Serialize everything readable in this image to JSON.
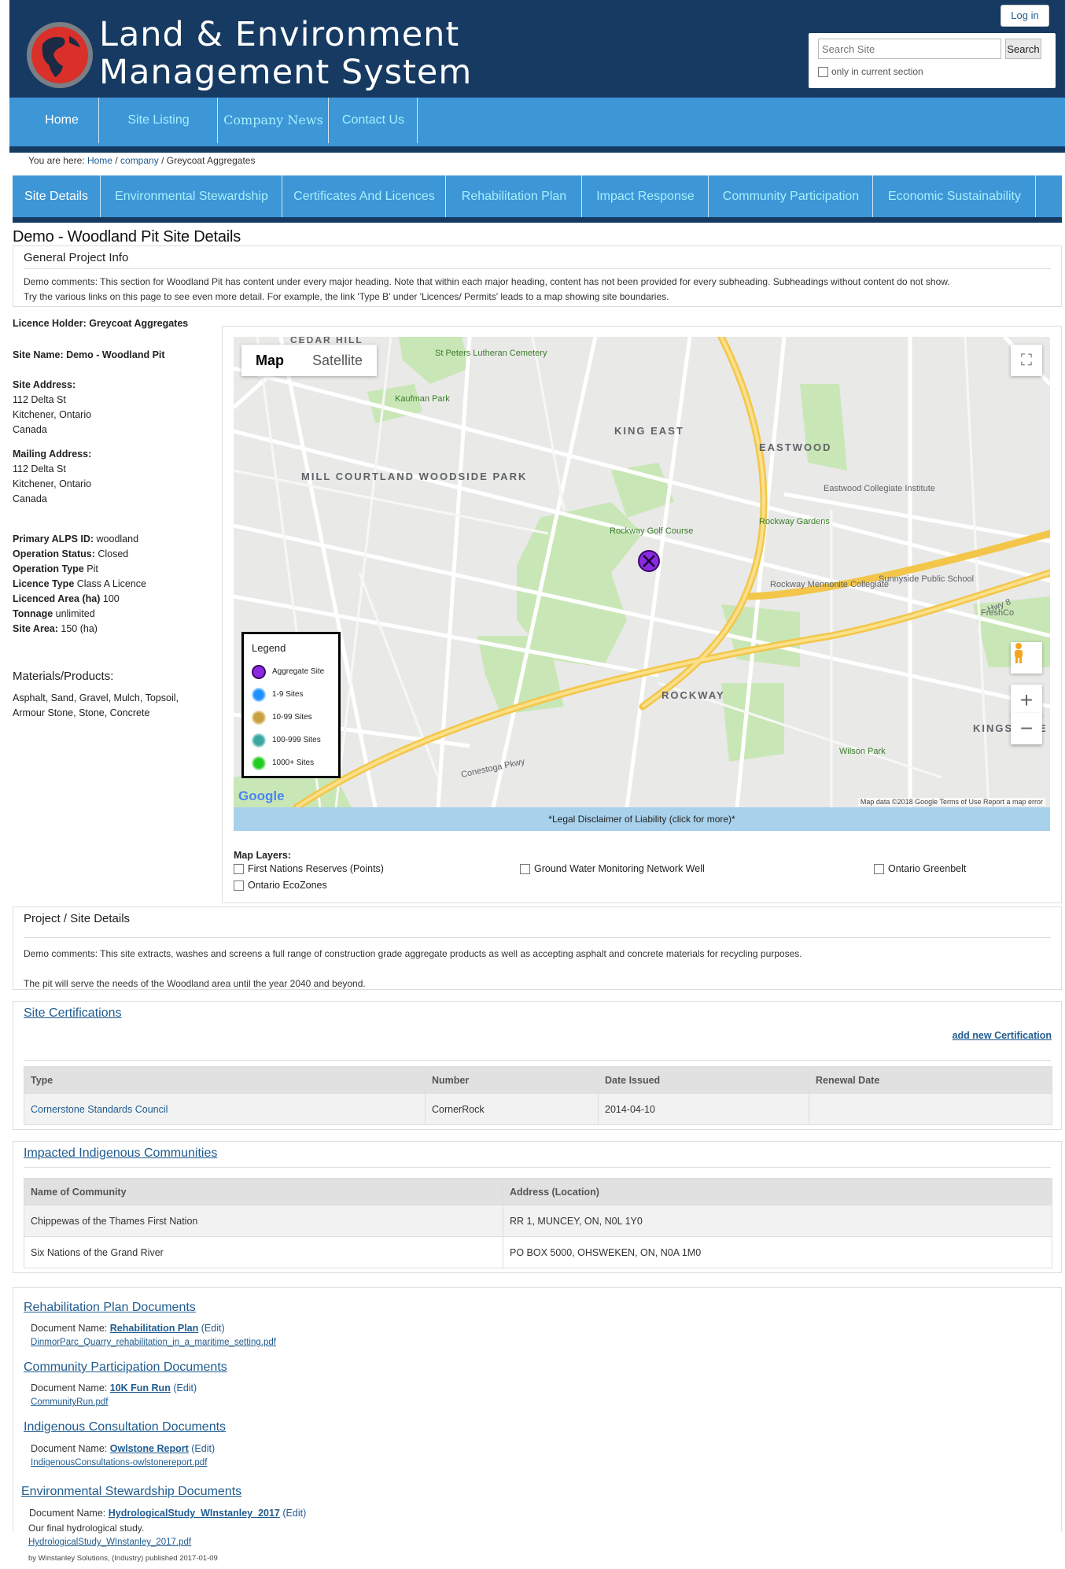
{
  "header": {
    "title_line1": "Land & Environment",
    "title_line2": "Management System",
    "login_label": "Log in",
    "search_placeholder": "Search Site",
    "search_button": "Search",
    "only_current_section": "only in current section",
    "brand_color": "#163a62",
    "nav_color": "#3d96d6"
  },
  "nav": {
    "home": "Home",
    "site_listing": "Site Listing",
    "company_news": "Company News",
    "contact_us": "Contact Us"
  },
  "breadcrumb": {
    "prefix": "You are here:",
    "home": "Home",
    "sep1": "/",
    "company": "company",
    "sep2": "/",
    "current": "Greycoat Aggregates"
  },
  "tabs": [
    {
      "label": "Site Details"
    },
    {
      "label": "Environmental Stewardship"
    },
    {
      "label": "Certificates And Licences"
    },
    {
      "label": "Rehabilitation Plan"
    },
    {
      "label": "Impact Response"
    },
    {
      "label": "Community Participation"
    },
    {
      "label": "Economic Sustainability"
    }
  ],
  "page_title": "Demo - Woodland Pit Site Details",
  "general_info": {
    "heading": "General Project Info",
    "line1": "Demo comments: This section for Woodland Pit has content under every major heading.  Note that within each major heading, content has not been provided for every subheading.  Subheadings without content do not show.",
    "line2": "Try the various links on this page to see even more detail.  For example, the link 'Type B' under 'Licences/ Permits' leads to a map showing site boundaries."
  },
  "site": {
    "licence_holder": "Licence Holder: Greycoat Aggregates",
    "site_name": "Site Name: Demo - Woodland Pit",
    "site_address_label": "Site Address:",
    "site_address": [
      "112 Delta St",
      "Kitchener, Ontario",
      "Canada"
    ],
    "mailing_address_label": "Mailing Address:",
    "mailing_address": [
      "112 Delta St",
      "Kitchener, Ontario",
      "Canada"
    ],
    "details": [
      {
        "label": "Primary ALPS ID:",
        "value": " woodland"
      },
      {
        "label": "Operation Status:",
        "value": " Closed"
      },
      {
        "label": "Operation Type",
        "value": " Pit"
      },
      {
        "label": "Licence Type",
        "value": " Class A Licence"
      },
      {
        "label": "Licenced Area (ha)",
        "value": " 100"
      },
      {
        "label": "Tonnage",
        "value": " unlimited"
      },
      {
        "label": "Site Area:",
        "value": " 150 (ha)"
      }
    ],
    "materials_heading": "Materials/Products:",
    "materials_line1": "Asphalt, Sand, Gravel, Mulch, Topsoil,",
    "materials_line2": "Armour Stone, Stone, Concrete"
  },
  "map": {
    "map_button": "Map",
    "satellite_button": "Satellite",
    "legend_title": "Legend",
    "legend": [
      {
        "label": "Aggregate Site",
        "color": "#8a2be2"
      },
      {
        "label": "1-9 Sites",
        "color": "#1e90ff"
      },
      {
        "label": "10-99 Sites",
        "color": "#c8a040"
      },
      {
        "label": "100-999 Sites",
        "color": "#3aa6a0"
      },
      {
        "label": "1000+ Sites",
        "color": "#22cc22"
      }
    ],
    "labels": [
      "CEDAR HILL",
      "Kaufman Park",
      "St Peters Lutheran Cemetery",
      "KING EAST",
      "EASTWOOD",
      "MILL COURTLAND WOODSIDE PARK",
      "Rockway Golf Course",
      "Rockway Gardens",
      "Eastwood Collegiate Institute",
      "Sunnyside Public School",
      "Rockway Mennonite Collegiate",
      "FreshCo",
      "ROCKWAY",
      "Conestoga Pkwy",
      "Wilson Park",
      "KINGSDALE",
      "Hwy 8"
    ],
    "google": "Google",
    "attribution": "Map data ©2018 Google   Terms of Use   Report a map error",
    "disclaimer": "*Legal Disclaimer of Liability (click for more)*",
    "layers_heading": "Map Layers:",
    "layers": [
      "First Nations Reserves (Points)",
      "Ground Water Monitoring Network Well",
      "Ontario Greenbelt",
      "Ontario EcoZones"
    ]
  },
  "project_details": {
    "heading": "Project / Site Details",
    "line1": "Demo comments: This site extracts, washes and screens a full range of construction grade aggregate products as well as accepting asphalt and concrete materials for recycling purposes.",
    "line2": "The pit will serve the needs of the Woodland area until the year 2040 and beyond."
  },
  "certifications": {
    "heading": "Site Certifications",
    "add_new": "add new Certification",
    "columns": [
      "Type",
      "Number",
      "Date Issued",
      "Renewal Date"
    ],
    "rows": [
      {
        "type": "Cornerstone Standards Council",
        "number": "CornerRock",
        "date_issued": "2014-04-10",
        "renewal": ""
      }
    ]
  },
  "communities": {
    "heading": "Impacted Indigenous Communities",
    "columns": [
      "Name of Community",
      "Address (Location)"
    ],
    "rows": [
      {
        "name": "Chippewas of the Thames First Nation",
        "address": "RR 1, MUNCEY, ON, N0L 1Y0"
      },
      {
        "name": "Six Nations of the Grand River",
        "address": "PO BOX 5000, OHSWEKEN, ON, N0A 1M0"
      }
    ]
  },
  "documents": {
    "doc_name_label": "Document Name:",
    "edit_label": "(Edit)",
    "groups": [
      {
        "heading": "Rehabilitation Plan Documents",
        "name": "Rehabilitation Plan",
        "file": "DinmorParc_Quarry_rehabilitation_in_a_maritime_setting.pdf"
      },
      {
        "heading": "Community Participation Documents",
        "name": "10K Fun Run",
        "file": "CommunityRun.pdf"
      },
      {
        "heading": "Indigenous Consultation Documents",
        "name": "Owlstone Report",
        "file": "IndigenousConsultations-owlstonereport.pdf"
      },
      {
        "heading": "Environmental Stewardship Documents",
        "name": "HydrologicalStudy_WInstanley_2017",
        "file": "HydrologicalStudy_WInstanley_2017.pdf",
        "description": "Our final hydrological study.",
        "publisher": "by Winstanley Solutions, (Industry) published 2017-01-09"
      }
    ]
  }
}
